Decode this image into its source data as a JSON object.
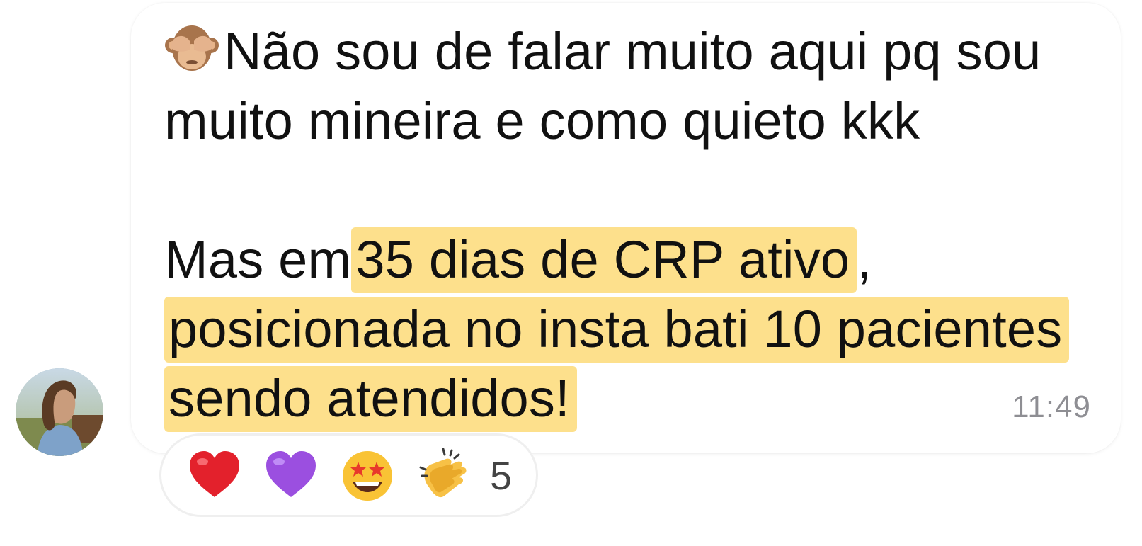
{
  "message": {
    "lines": [
      "Não sou de falar muito aqui pq sou",
      "muito mineira e como quieto kkk",
      "",
      "Mas em",
      "35 dias de CRP ativo",
      ",",
      "posicionada no insta bati 10 pacientes",
      "sendo atendidos!"
    ],
    "time": "11:49",
    "leading_emoji": "see-no-evil-monkey-icon"
  },
  "reactions": {
    "items": [
      "red-heart-icon",
      "purple-heart-icon",
      "star-struck-icon",
      "clapping-hands-icon"
    ],
    "count": "5"
  },
  "colors": {
    "highlight": "#fde08c",
    "time": "#8e8e93",
    "text": "#111111"
  }
}
